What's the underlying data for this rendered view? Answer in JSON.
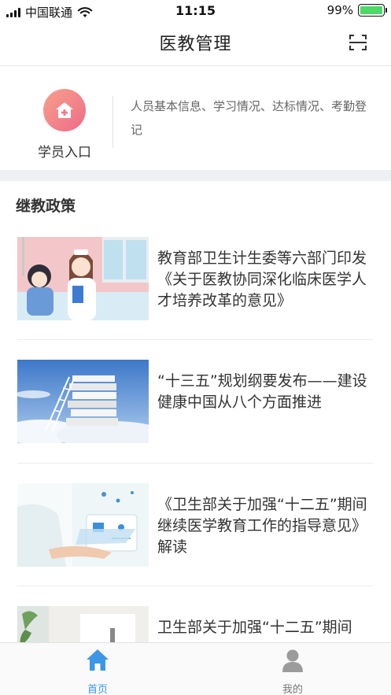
{
  "status_bar": {
    "carrier": "中国联通",
    "time": "11:15",
    "battery": "99%",
    "battery_level": 0.99
  },
  "nav": {
    "title": "医教管理",
    "scan_icon": "scan-icon"
  },
  "entry": {
    "label": "学员入口",
    "description": "人员基本信息、学习情况、达标情况、考勤登记",
    "icon": "home-icon",
    "icon_gradient": [
      "#f7a08a",
      "#ef6b8a"
    ]
  },
  "section": {
    "title": "继教政策"
  },
  "news": [
    {
      "title": "教育部卫生计生委等六部门印发《关于医教协同深化临床医学人才培养改革的意见》",
      "thumb": "nurse-patient-illustration"
    },
    {
      "title": "“十三五”规划纲要发布——建设健康中国从八个方面推进",
      "thumb": "books-ladder-sky-photo"
    },
    {
      "title": "《卫生部关于加强“十二五”期间继续医学教育工作的指导意见》解读",
      "thumb": "doctor-tablet-photo"
    },
    {
      "title": "卫生部关于加强“十二五”期间",
      "thumb": "clinic-photo"
    }
  ],
  "tabs": [
    {
      "label": "首页",
      "icon": "home-tab-icon",
      "active": true
    },
    {
      "label": "我的",
      "icon": "user-tab-icon",
      "active": false
    }
  ],
  "colors": {
    "accent": "#3d96e6",
    "battery_green": "#4cd964",
    "separator": "#eef0f4"
  }
}
